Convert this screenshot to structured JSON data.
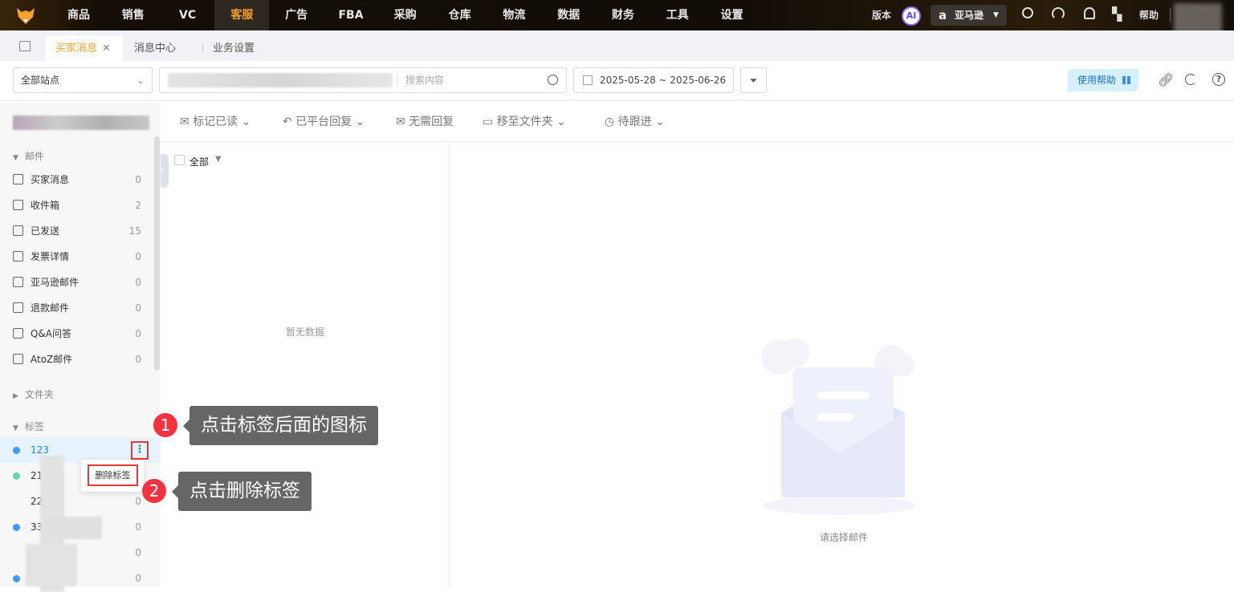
{
  "topnav": {
    "items": [
      "商品",
      "销售",
      "VC",
      "客服",
      "广告",
      "FBA",
      "采购",
      "仓库",
      "物流",
      "数据",
      "财务",
      "工具",
      "设置"
    ],
    "active": "客服",
    "version": "版本",
    "ai": "AI",
    "marketplace": "亚马逊",
    "help": "帮助"
  },
  "tabs": [
    {
      "label": "买家消息",
      "active": true
    },
    {
      "label": "消息中心"
    },
    {
      "label": "业务设置"
    }
  ],
  "filter": {
    "site": "全部站点",
    "search_placeholder": "搜索内容",
    "date_range": "2025-05-28 ~ 2025-06-26",
    "help_button": "使用帮助"
  },
  "toolbar": {
    "mark_read": "标记已读",
    "platform_replied": "已平台回复",
    "no_reply": "无需回复",
    "move_folder": "移至文件夹",
    "follow_up": "待跟进"
  },
  "sidebar": {
    "mail_header": "邮件",
    "mail_items": [
      {
        "label": "买家消息",
        "count": "0"
      },
      {
        "label": "收件箱",
        "count": "2"
      },
      {
        "label": "已发送",
        "count": "15"
      },
      {
        "label": "发票详情",
        "count": "0"
      },
      {
        "label": "亚马逊邮件",
        "count": "0"
      },
      {
        "label": "退款邮件",
        "count": "0"
      },
      {
        "label": "Q&A问答",
        "count": "0"
      },
      {
        "label": "AtoZ邮件",
        "count": "0"
      }
    ],
    "folder_header": "文件夹",
    "tag_header": "标签",
    "tags": [
      {
        "label": "123",
        "count": "",
        "color": "#3a9cf5"
      },
      {
        "label": "21",
        "count": "",
        "color": "#5fd8a5"
      },
      {
        "label": "22",
        "count": "0",
        "color": ""
      },
      {
        "label": "33",
        "count": "0",
        "color": "#3a9cf5"
      },
      {
        "label": "",
        "count": "0",
        "color": ""
      },
      {
        "label": "",
        "count": "0",
        "color": "#3a9cf5"
      }
    ]
  },
  "context_menu": {
    "delete_tag": "删除标签"
  },
  "list": {
    "select_all": "全部",
    "empty": "暂无数据"
  },
  "detail": {
    "empty": "请选择邮件"
  },
  "annotations": [
    {
      "number": "1",
      "text": "点击标签后面的图标"
    },
    {
      "number": "2",
      "text": "点击删除标签"
    }
  ],
  "colors": {
    "accent": "#f7a32b",
    "link": "#1e88e5",
    "annotation": "#f5333f"
  }
}
